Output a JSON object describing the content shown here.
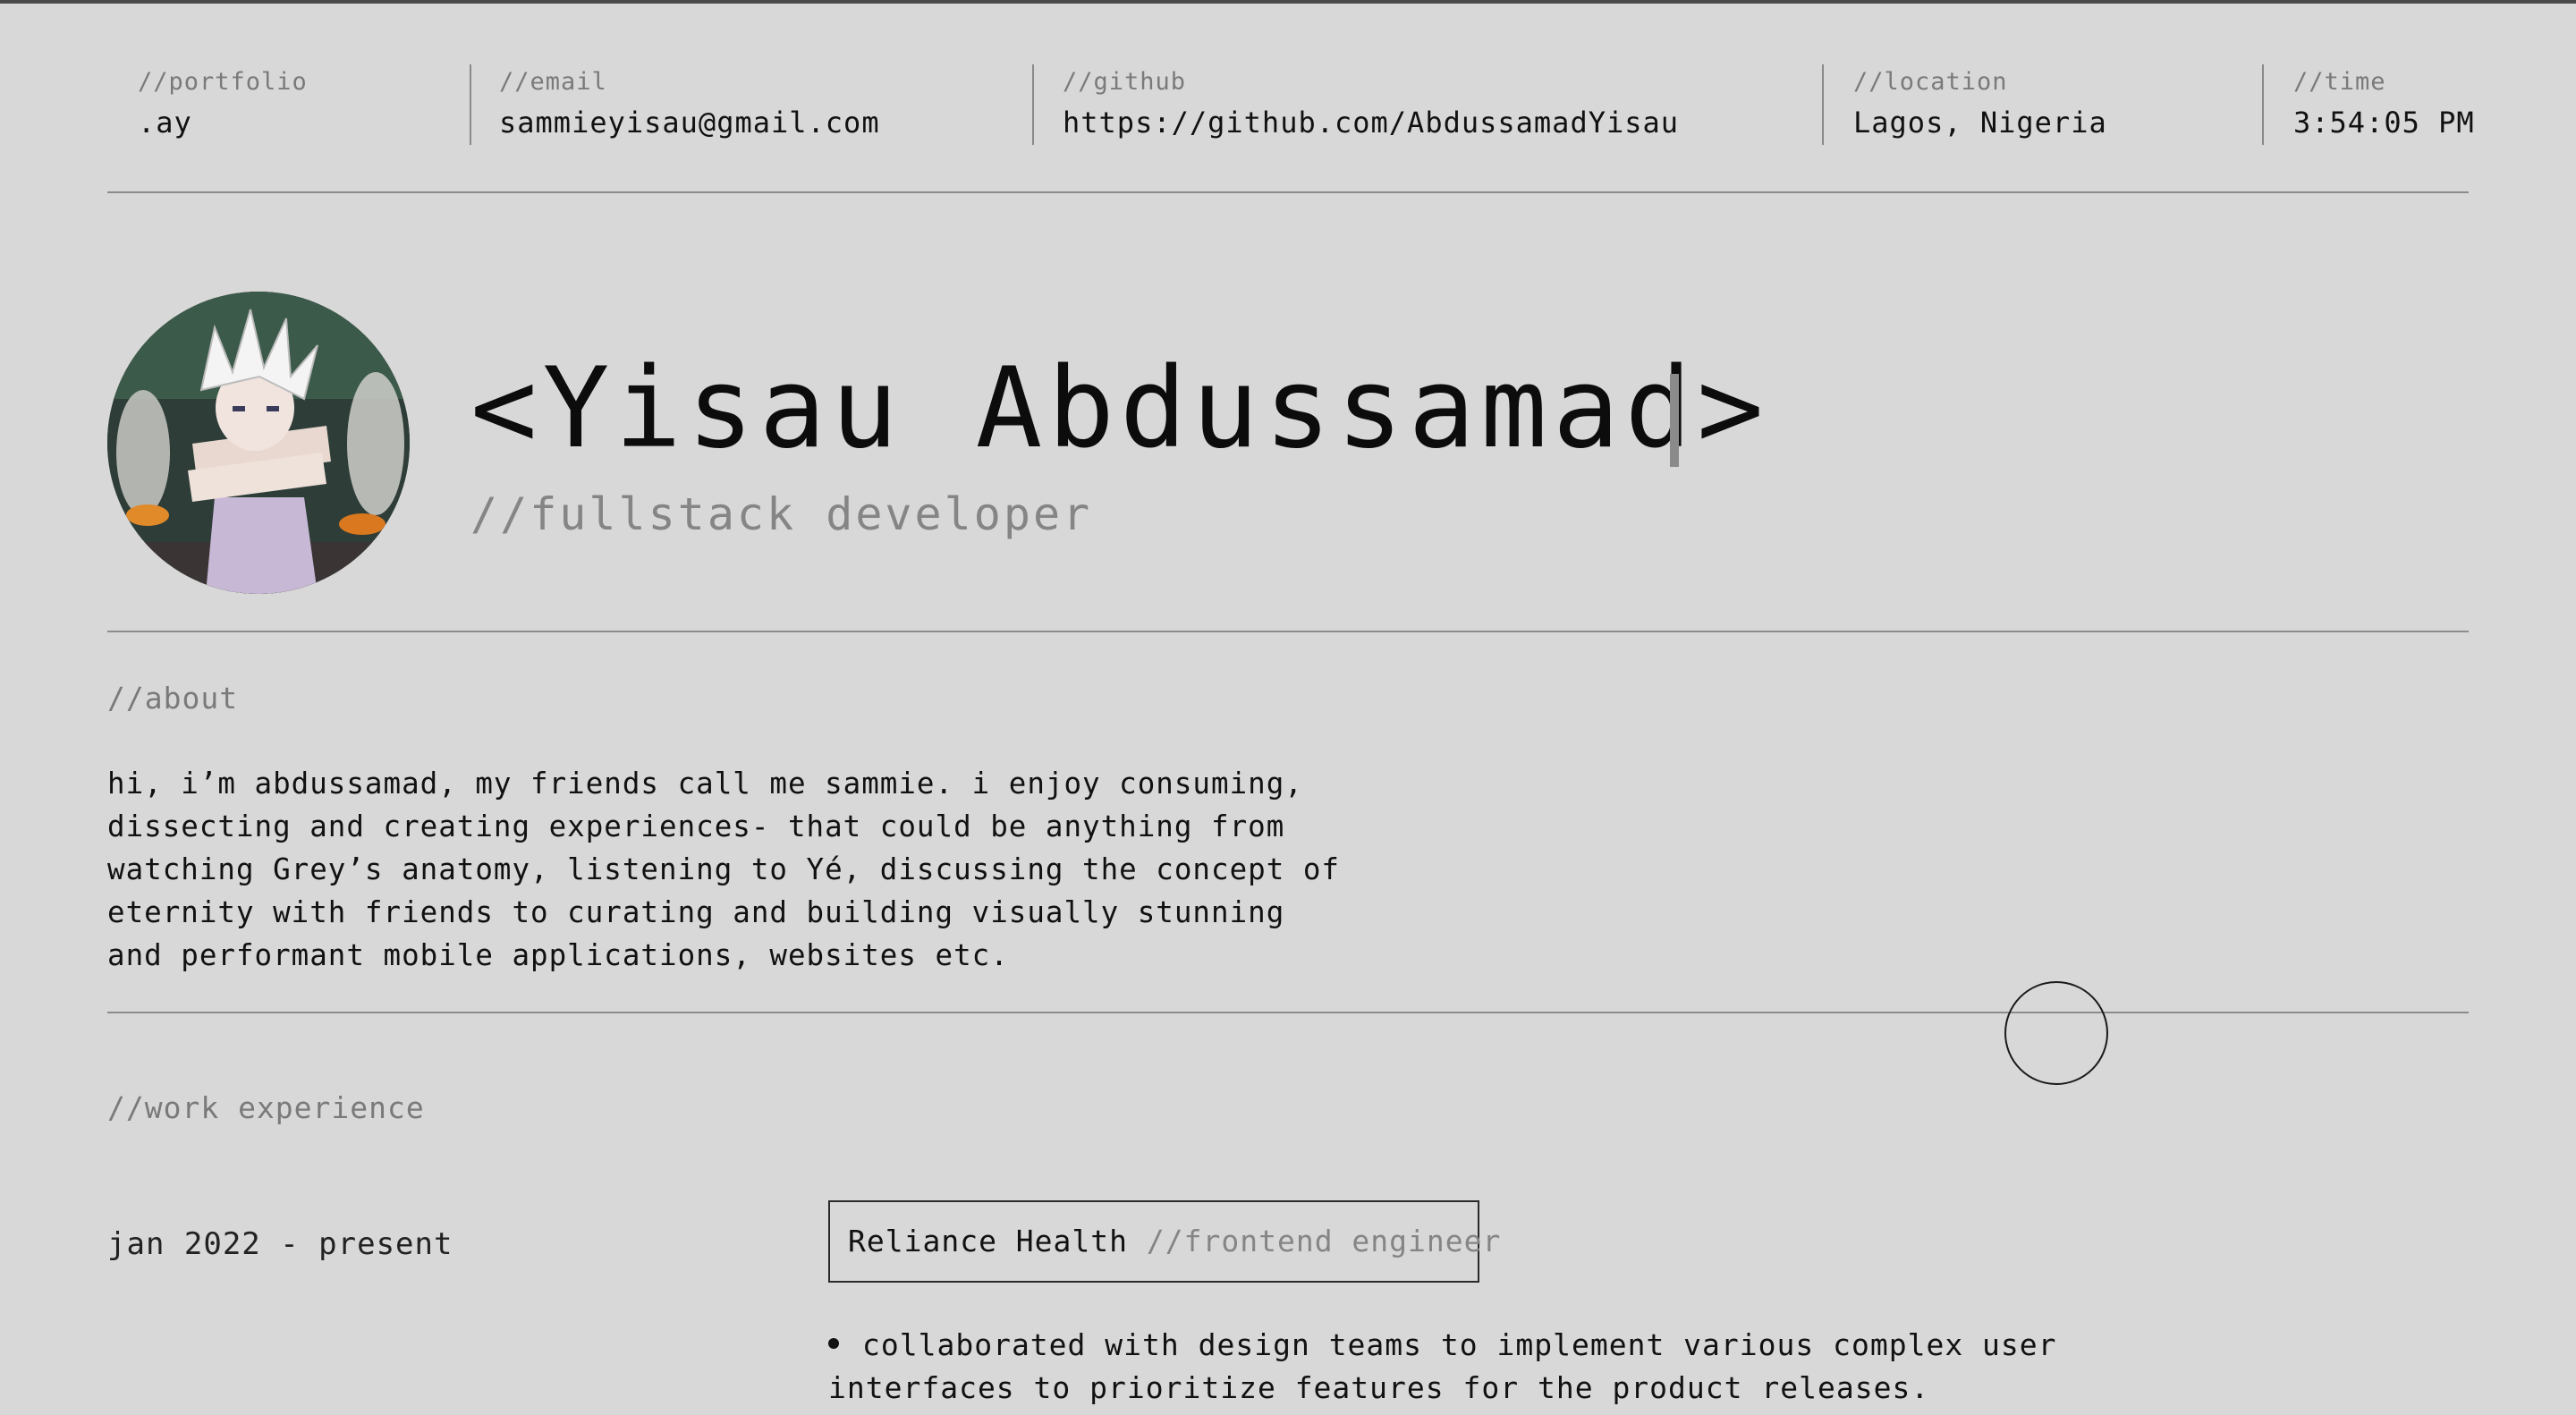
{
  "header": {
    "portfolio": {
      "label": "//portfolio",
      "value": ".ay"
    },
    "email": {
      "label": "//email",
      "value": "sammieyisau@gmail.com"
    },
    "github": {
      "label": "//github",
      "value": "https://github.com/AbdussamadYisau"
    },
    "location": {
      "label": "//location",
      "value": "Lagos, Nigeria"
    },
    "time": {
      "label": "//time",
      "value": "3:54:05 PM"
    }
  },
  "hero": {
    "name": "<Yisau Abdussamad>",
    "role": "//fullstack developer",
    "avatar_icon": "anime-character-avatar"
  },
  "about": {
    "label": "//about",
    "lines": [
      "hi, i’m abdussamad, my friends call me sammie. i enjoy consuming,",
      "dissecting and creating experiences- that could be anything from",
      "watching Grey’s anatomy, listening to Yé, discussing the concept of",
      "eternity with friends to curating and building visually stunning",
      "and performant mobile applications, websites etc."
    ]
  },
  "work": {
    "label": "//work experience",
    "jobs": [
      {
        "period": "jan 2022 - present",
        "company": "Reliance Health",
        "role": "//frontend engineer",
        "bullet_lines": [
          "collaborated with design teams to implement various complex user",
          "interfaces to prioritize features for the product releases."
        ]
      }
    ]
  },
  "colors": {
    "background": "#d8d8d8",
    "text": "#111111",
    "muted": "#858585",
    "rule": "#8c8c8c"
  }
}
